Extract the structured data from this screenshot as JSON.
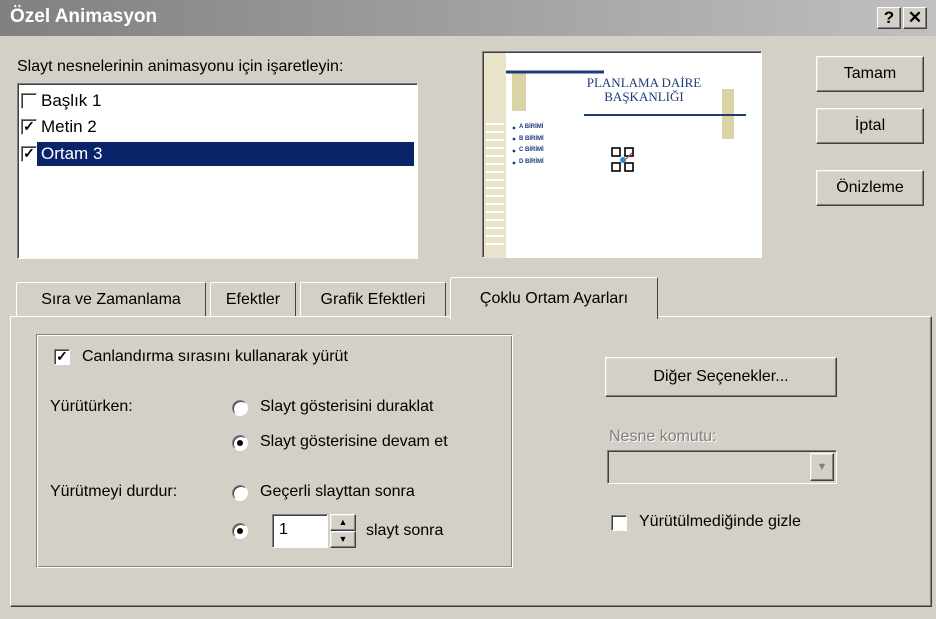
{
  "window": {
    "title": "Özel Animasyon",
    "help_glyph": "?",
    "close_glyph": "✕"
  },
  "objects": {
    "label": "Slayt nesnelerinin animasyonu için işaretleyin:",
    "items": [
      {
        "label": "Başlık 1",
        "checked": false,
        "selected": false
      },
      {
        "label": "Metin 2",
        "checked": true,
        "selected": false
      },
      {
        "label": "Ortam 3",
        "checked": true,
        "selected": true
      }
    ]
  },
  "preview": {
    "title_line1": "PLANLAMA DAİRE",
    "title_line2": "BAŞKANLIĞI",
    "bullets": [
      "A BİRİMİ",
      "B BİRİMİ",
      "C BİRİMİ",
      "D BİRİMİ"
    ]
  },
  "buttons": {
    "ok": "Tamam",
    "cancel": "İptal",
    "preview": "Önizleme"
  },
  "tabs": [
    {
      "label": "Sıra ve Zamanlama",
      "active": false
    },
    {
      "label": "Efektler",
      "active": false
    },
    {
      "label": "Grafik Efektleri",
      "active": false
    },
    {
      "label": "Çoklu Ortam Ayarları",
      "active": true
    }
  ],
  "multimedia": {
    "play_in_order_label": "Canlandırma sırasını kullanarak yürüt",
    "play_in_order_checked": true,
    "while_playing_label": "Yürütürken:",
    "pause_label": "Slayt gösterisini duraklat",
    "continue_label": "Slayt gösterisine devam et",
    "while_playing_selected": "continue",
    "stop_label": "Yürütmeyi durdur:",
    "after_current_label": "Geçerli slayttan sonra",
    "after_n_value": "1",
    "after_n_suffix": "slayt sonra",
    "stop_selected": "after_n",
    "more_options": "Diğer Seçenekler...",
    "object_action_label": "Nesne komutu:",
    "object_action_value": "",
    "hide_label": "Yürütülmediğinde gizle",
    "hide_checked": false
  }
}
